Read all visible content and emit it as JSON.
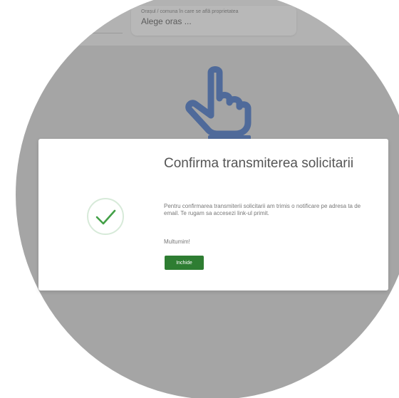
{
  "background_page": {
    "city_field": {
      "hint": "Orașul / comuna în care se află proprietatea",
      "value": "Alege oras ..."
    },
    "hand_icon": "pointing-hand-icon"
  },
  "modal": {
    "title": "Confirma transmiterea solicitarii",
    "body": "Pentru confirmarea transmiterii solicitarii am trimis o notificare pe adresa ta de email. Te rugam sa accesezi link-ul primit.",
    "thanks": "Multumim!",
    "close_label": "Inchide",
    "icon": "check-circle-icon"
  },
  "colors": {
    "overlay": "#a5a5a5",
    "accent_green": "#2e7d32",
    "check_green": "#43a047",
    "hand_blue": "#4f6a9a"
  }
}
